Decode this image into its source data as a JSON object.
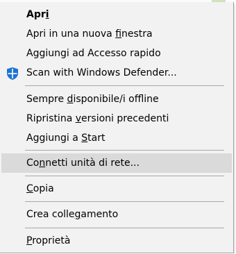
{
  "menu": {
    "items": [
      {
        "id": "apri",
        "pre": "Apr",
        "acc": "i",
        "post": ""
      },
      {
        "id": "apri-nuova",
        "pre": "Apri in una nuova ",
        "acc": "f",
        "post": "inestra"
      },
      {
        "id": "accesso-rapido",
        "pre": "Aggiungi ad Accesso rapido",
        "acc": "",
        "post": ""
      },
      {
        "id": "defender",
        "pre": "Scan with Windows Defender...",
        "acc": "",
        "post": "",
        "icon": "windows-defender-shield-icon"
      },
      {
        "id": "offline",
        "pre": "Sempre ",
        "acc": "d",
        "post": "isponibile/i offline"
      },
      {
        "id": "versioni",
        "pre": "Ripristina ",
        "acc": "v",
        "post": "ersioni precedenti"
      },
      {
        "id": "start",
        "pre": "Aggiungi a ",
        "acc": "S",
        "post": "tart"
      },
      {
        "id": "connetti",
        "pre": "Co",
        "acc": "n",
        "post": "netti unità di rete..."
      },
      {
        "id": "copia",
        "pre": "",
        "acc": "C",
        "post": "opia"
      },
      {
        "id": "collegamento",
        "pre": "Crea colle",
        "acc": "g",
        "post": "amento"
      },
      {
        "id": "proprieta",
        "pre": "",
        "acc": "P",
        "post": "roprietà"
      }
    ]
  },
  "colors": {
    "menu_bg": "#f2f2f2",
    "highlight_bg": "#dadada",
    "separator": "#a8a8a8",
    "shield_blue": "#1e73d2"
  }
}
